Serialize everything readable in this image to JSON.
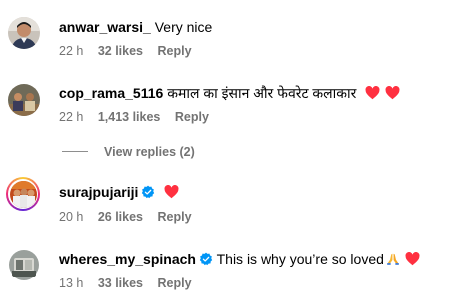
{
  "comments": [
    {
      "username": "anwar_warsi_",
      "text": "Very nice",
      "time": "22 h",
      "likes": "32 likes",
      "reply": "Reply",
      "avatar_icon": "user-photo-icon"
    },
    {
      "username": "cop_rama_5116",
      "text": "कमाल का इंसान और फेवरेट कलाकार",
      "emoji": "red-heart-icon red-heart-icon",
      "time": "22 h",
      "likes": "1,413 likes",
      "reply": "Reply",
      "avatar_icon": "user-photo-icon"
    },
    {
      "username": "surajpujariji",
      "verified": true,
      "emoji": "red-heart-icon",
      "time": "20 h",
      "likes": "26 likes",
      "reply": "Reply",
      "avatar_icon": "story-ring-photo-icon"
    },
    {
      "username": "wheres_my_spinach",
      "verified": true,
      "text": "This is why you’re so loved",
      "emoji": "folded-hands-icon red-heart-icon",
      "time": "13 h",
      "likes": "33 likes",
      "reply": "Reply",
      "avatar_icon": "user-photo-icon"
    }
  ],
  "view_replies": "View replies (2)",
  "colors": {
    "meta_gray": "#737373",
    "verified_blue": "#0095f6",
    "heart_red": "#ff3040"
  }
}
